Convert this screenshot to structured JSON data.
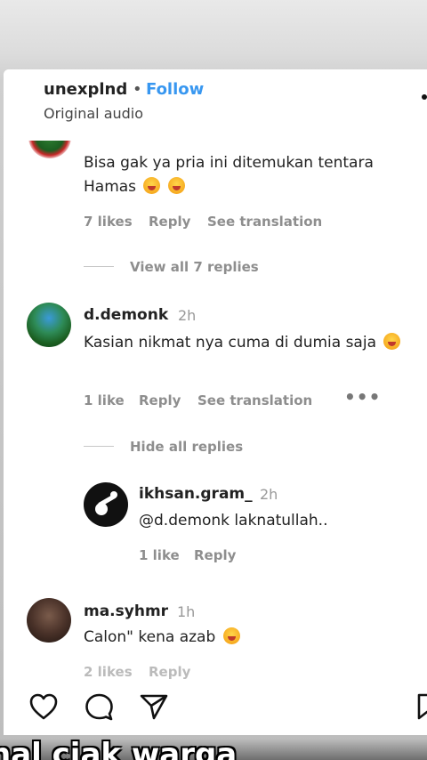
{
  "header": {
    "username": "unexplnd",
    "separator": "•",
    "follow": "Follow",
    "audio": "Original audio"
  },
  "comments": [
    {
      "text": "Bisa gak ya pria ini ditemukan tentara Hamas",
      "likes": "7 likes",
      "reply": "Reply",
      "translation": "See translation",
      "view_replies": "View all 7 replies"
    },
    {
      "username": "d.demonk",
      "time": "2h",
      "text": "Kasian nikmat nya cuma di dumia saja",
      "likes": "1 like",
      "reply": "Reply",
      "translation": "See translation",
      "more": "•••",
      "hide_replies": "Hide all replies",
      "replies": [
        {
          "username": "ikhsan.gram_",
          "time": "2h",
          "text": "@d.demonk laknatullah..",
          "likes": "1 like",
          "reply": "Reply"
        }
      ]
    },
    {
      "username": "ma.syhmr",
      "time": "1h",
      "text": "Calon\" kena azab",
      "likes": "2 likes",
      "reply": "Reply"
    }
  ],
  "actions": [
    "heart-icon",
    "comment-icon",
    "share-icon",
    "bookmark-icon"
  ],
  "overlay": {
    "caption": "nal ciak warga"
  },
  "colors": {
    "follow": "#3897f0",
    "muted": "#8e8e8e"
  }
}
